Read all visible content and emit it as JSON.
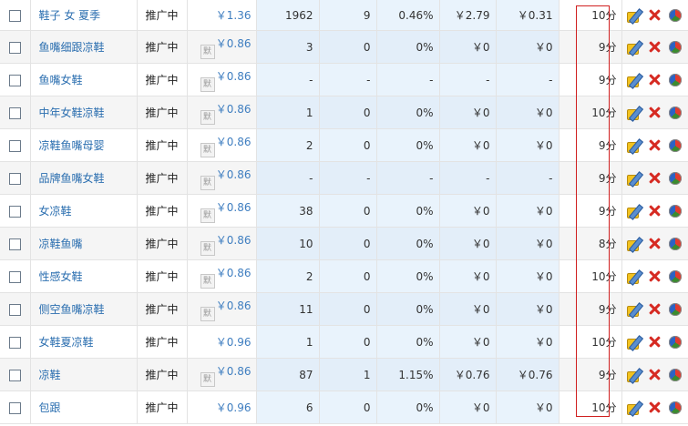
{
  "highlight_color": "#d02020",
  "rows": [
    {
      "keyword": "鞋子 女 夏季",
      "status": "推广中",
      "bid_mark": "",
      "bid": "￥1.36",
      "impressions": "1962",
      "clicks": "9",
      "ctr": "0.46%",
      "cost": "￥2.79",
      "cpc": "￥0.31",
      "score": "10分"
    },
    {
      "keyword": "鱼嘴细跟凉鞋",
      "status": "推广中",
      "bid_mark": "默",
      "bid": "￥0.86",
      "impressions": "3",
      "clicks": "0",
      "ctr": "0%",
      "cost": "￥0",
      "cpc": "￥0",
      "score": "9分"
    },
    {
      "keyword": "鱼嘴女鞋",
      "status": "推广中",
      "bid_mark": "默",
      "bid": "￥0.86",
      "impressions": "-",
      "clicks": "-",
      "ctr": "-",
      "cost": "-",
      "cpc": "-",
      "score": "9分"
    },
    {
      "keyword": "中年女鞋凉鞋",
      "status": "推广中",
      "bid_mark": "默",
      "bid": "￥0.86",
      "impressions": "1",
      "clicks": "0",
      "ctr": "0%",
      "cost": "￥0",
      "cpc": "￥0",
      "score": "10分"
    },
    {
      "keyword": "凉鞋鱼嘴母婴",
      "status": "推广中",
      "bid_mark": "默",
      "bid": "￥0.86",
      "impressions": "2",
      "clicks": "0",
      "ctr": "0%",
      "cost": "￥0",
      "cpc": "￥0",
      "score": "9分"
    },
    {
      "keyword": "品牌鱼嘴女鞋",
      "status": "推广中",
      "bid_mark": "默",
      "bid": "￥0.86",
      "impressions": "-",
      "clicks": "-",
      "ctr": "-",
      "cost": "-",
      "cpc": "-",
      "score": "9分"
    },
    {
      "keyword": "女凉鞋",
      "status": "推广中",
      "bid_mark": "默",
      "bid": "￥0.86",
      "impressions": "38",
      "clicks": "0",
      "ctr": "0%",
      "cost": "￥0",
      "cpc": "￥0",
      "score": "9分"
    },
    {
      "keyword": "凉鞋鱼嘴",
      "status": "推广中",
      "bid_mark": "默",
      "bid": "￥0.86",
      "impressions": "10",
      "clicks": "0",
      "ctr": "0%",
      "cost": "￥0",
      "cpc": "￥0",
      "score": "8分"
    },
    {
      "keyword": "性感女鞋",
      "status": "推广中",
      "bid_mark": "默",
      "bid": "￥0.86",
      "impressions": "2",
      "clicks": "0",
      "ctr": "0%",
      "cost": "￥0",
      "cpc": "￥0",
      "score": "10分"
    },
    {
      "keyword": "侧空鱼嘴凉鞋",
      "status": "推广中",
      "bid_mark": "默",
      "bid": "￥0.86",
      "impressions": "11",
      "clicks": "0",
      "ctr": "0%",
      "cost": "￥0",
      "cpc": "￥0",
      "score": "9分"
    },
    {
      "keyword": "女鞋夏凉鞋",
      "status": "推广中",
      "bid_mark": "",
      "bid": "￥0.96",
      "impressions": "1",
      "clicks": "0",
      "ctr": "0%",
      "cost": "￥0",
      "cpc": "￥0",
      "score": "10分"
    },
    {
      "keyword": "凉鞋",
      "status": "推广中",
      "bid_mark": "默",
      "bid": "￥0.86",
      "impressions": "87",
      "clicks": "1",
      "ctr": "1.15%",
      "cost": "￥0.76",
      "cpc": "￥0.76",
      "score": "9分"
    },
    {
      "keyword": "包跟",
      "status": "推广中",
      "bid_mark": "",
      "bid": "￥0.96",
      "impressions": "6",
      "clicks": "0",
      "ctr": "0%",
      "cost": "￥0",
      "cpc": "￥0",
      "score": "10分"
    }
  ],
  "row_icons": [
    "edit-icon",
    "delete-icon",
    "report-pie-icon"
  ]
}
